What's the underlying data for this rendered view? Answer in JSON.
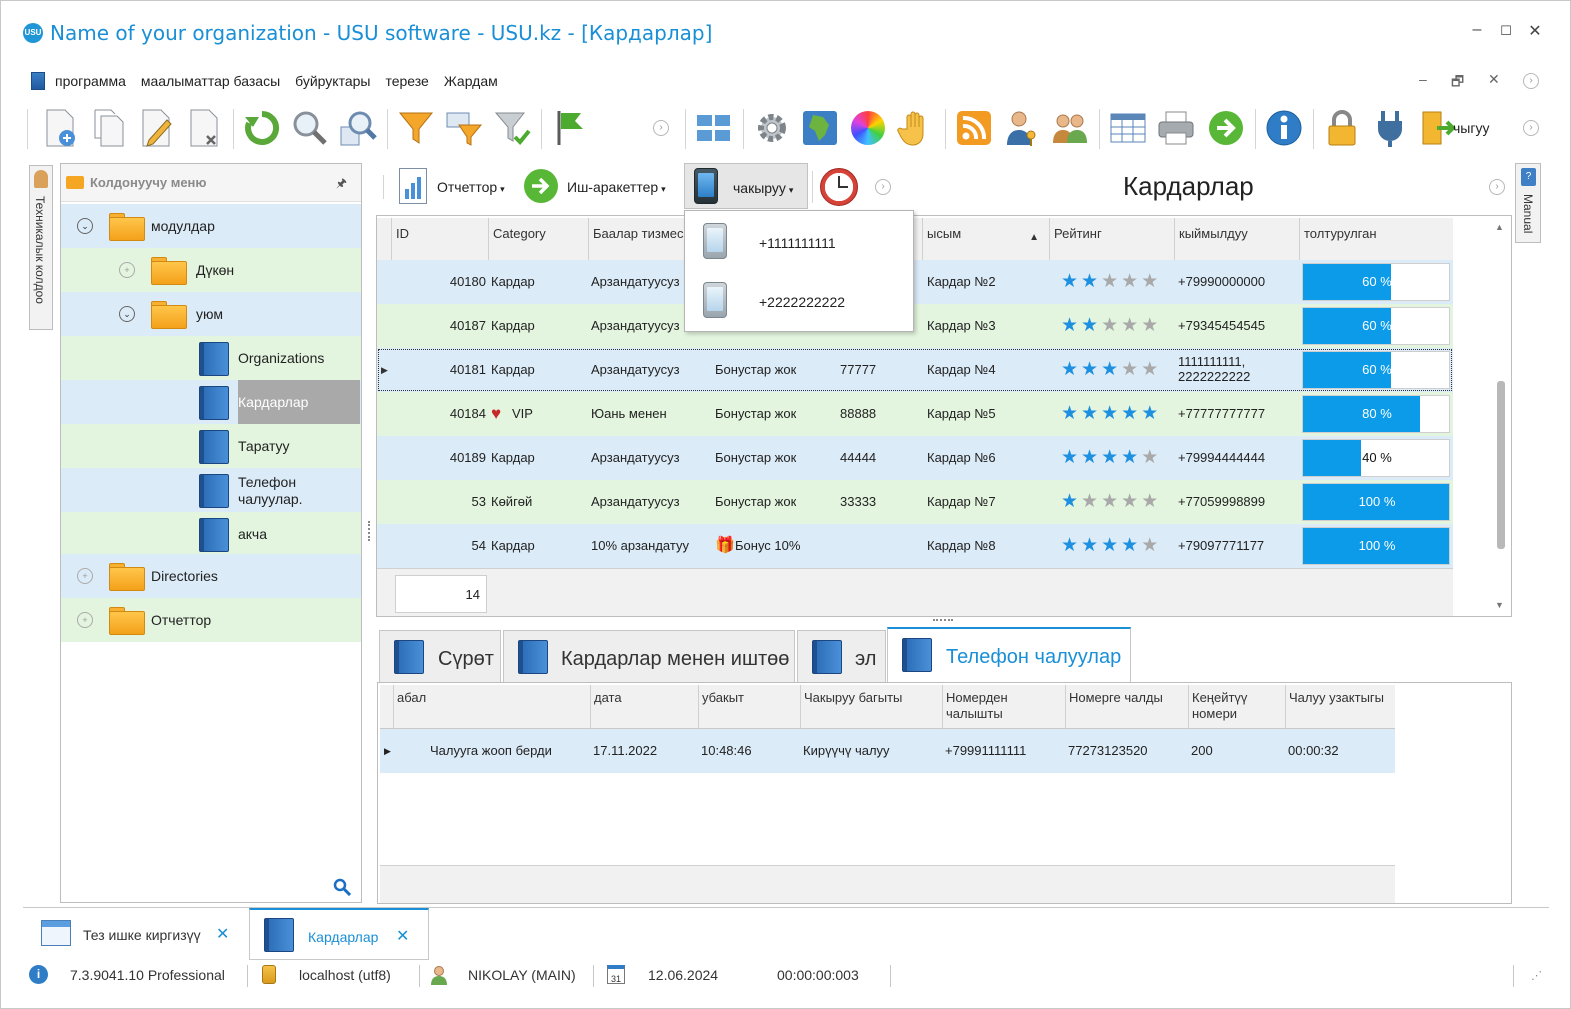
{
  "window": {
    "title": "Name of your organization - USU software - USU.kz - [Кардарлар]",
    "logo_text": "USU",
    "minimize": "–",
    "maximize": "☐",
    "close": "✕"
  },
  "menu": {
    "items": [
      "программа",
      "маалыматтар базасы",
      "буйруктары",
      "терезе",
      "Жардам"
    ],
    "mdi_minimize": "–",
    "mdi_restore": "🗗",
    "mdi_close": "✕"
  },
  "toolbar": {
    "exit_label": "чыгуу"
  },
  "left_vertical_tab": {
    "label": "Техникалык колдоо"
  },
  "right_vertical_tab": {
    "label": "Manual",
    "icon_text": "?"
  },
  "sidebar": {
    "title": "Колдонуучу меню",
    "pin": "🖈",
    "items": [
      {
        "label": "модулдар",
        "level": 0,
        "expanded": true
      },
      {
        "label": "Дүкөн",
        "level": 1,
        "expanded": false
      },
      {
        "label": "уюм",
        "level": 1,
        "expanded": true
      },
      {
        "label": "Organizations",
        "level": 2
      },
      {
        "label": "Кардарлар",
        "level": 2,
        "selected": true
      },
      {
        "label": "Таратуу",
        "level": 2
      },
      {
        "label": "Телефон чалуулар.",
        "level": 2
      },
      {
        "label": "акча",
        "level": 2
      },
      {
        "label": "Directories",
        "level": 0,
        "expanded": false
      },
      {
        "label": "Отчеттор",
        "level": 0,
        "expanded": false
      }
    ]
  },
  "inner_toolbar": {
    "reports": "Отчеттор",
    "actions": "Иш-аракеттер",
    "call": "чакыруу",
    "page_title": "Кардарлар"
  },
  "call_dropdown": {
    "options": [
      "+1111111111",
      "+2222222222"
    ]
  },
  "grid": {
    "columns": [
      "ID",
      "Category",
      "Баалар тизмеси",
      "",
      "",
      "ысым",
      "Рейтинг",
      "кыймылдуу",
      "толтурулган"
    ],
    "sort_indicator": "▲",
    "rows": [
      {
        "id": "40180",
        "category": "Кардар",
        "vip": false,
        "price": "Арзандатуусуз",
        "bonus": "",
        "card": "",
        "name": "Кардар №2",
        "rating": 2,
        "mobile": "+79990000000",
        "fill": 60,
        "fill_label": "60 %"
      },
      {
        "id": "40187",
        "category": "Кардар",
        "vip": false,
        "price": "Арзандатуусуз",
        "bonus": "",
        "card": "",
        "name": "Кардар №3",
        "rating": 2,
        "mobile": "+79345454545",
        "fill": 60,
        "fill_label": "60 %"
      },
      {
        "id": "40181",
        "category": "Кардар",
        "vip": false,
        "price": "Арзандатуусуз",
        "bonus": "Бонустар жок",
        "card": "77777",
        "name": "Кардар №4",
        "rating": 3,
        "mobile": "1111111111, 2222222222",
        "fill": 60,
        "fill_label": "60 %",
        "current": true
      },
      {
        "id": "40184",
        "category": "VIP",
        "vip": true,
        "price": "Юань менен",
        "bonus": "Бонустар жок",
        "card": "88888",
        "name": "Кардар №5",
        "rating": 5,
        "mobile": "+77777777777",
        "fill": 80,
        "fill_label": "80 %"
      },
      {
        "id": "40189",
        "category": "Кардар",
        "vip": false,
        "price": "Арзандатуусуз",
        "bonus": "Бонустар жок",
        "card": "44444",
        "name": "Кардар №6",
        "rating": 4,
        "mobile": "+79994444444",
        "fill": 40,
        "fill_label": "40 %"
      },
      {
        "id": "53",
        "category": "Көйгөй",
        "vip": false,
        "price": "Арзандатуусуз",
        "bonus": "Бонустар жок",
        "card": "33333",
        "name": "Кардар №7",
        "rating": 1,
        "mobile": "+77059998899",
        "fill": 100,
        "fill_label": "100 %"
      },
      {
        "id": "54",
        "category": "Кардар",
        "vip": false,
        "price": "10% арзандатуу",
        "bonus": "Бонус 10%",
        "bonus_gift": true,
        "card": "",
        "name": "Кардар №8",
        "rating": 4,
        "mobile": "+79097771177",
        "fill": 100,
        "fill_label": "100 %"
      }
    ],
    "count": "14"
  },
  "bottom_tabs": [
    "Сүрөт",
    "Кардарлар менен иштөө",
    "эл",
    "Телефон чалуулар"
  ],
  "calls_grid": {
    "columns": [
      "абал",
      "дата",
      "убакыт",
      "Чакыруу багыты",
      "Номерден чалышты",
      "Номерге чалды",
      "Кеңейтүү номери",
      "Чалуу узактыгы"
    ],
    "rows": [
      {
        "status": "Чалууга жооп берди",
        "date": "17.11.2022",
        "time": "10:48:46",
        "direction": "Кирүүчү чалуу",
        "from": "+79991111111",
        "to": "77273123520",
        "ext": "200",
        "duration": "00:00:32"
      }
    ]
  },
  "window_tabs": [
    {
      "label": "Тез ишке киргизүү",
      "close": "✕"
    },
    {
      "label": "Кардарлар",
      "close": "✕",
      "active": true
    }
  ],
  "statusbar": {
    "version": "7.3.9041.10 Professional",
    "db": "localhost (utf8)",
    "user": "NIKOLAY (MAIN)",
    "calendar_day": "31",
    "date": "12.06.2024",
    "timer": "00:00:00:003"
  },
  "colors": {
    "accent": "#1a8fd6",
    "row_blue": "#dcebf8",
    "row_green": "#e3f5df",
    "progress": "#0b9be8",
    "star_on": "#1e90e0",
    "star_off": "#a9a9a9"
  }
}
